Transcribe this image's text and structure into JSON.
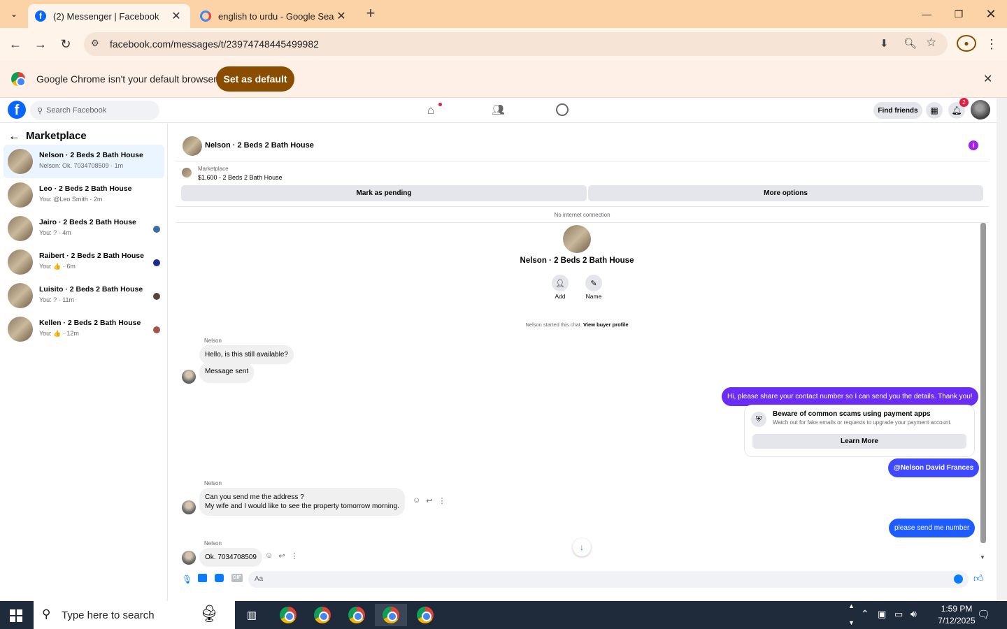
{
  "browser": {
    "tabs": [
      {
        "title": "(2) Messenger | Facebook",
        "active": true
      },
      {
        "title": "english to urdu - Google Search",
        "active": false
      }
    ],
    "url": "facebook.com/messages/t/23974748445499982",
    "default_banner": {
      "message": "Google Chrome isn't your default browser",
      "button": "Set as default"
    }
  },
  "fb_header": {
    "search_placeholder": "Search Facebook",
    "find_friends": "Find friends",
    "notification_count": "2"
  },
  "sidebar": {
    "title": "Marketplace",
    "conversations": [
      {
        "name": "Nelson · 2 Beds 2 Bath House",
        "preview": "Nelson: Ok. 7034708509 · 1m",
        "selected": true,
        "seen_color": ""
      },
      {
        "name": "Leo · 2 Beds 2 Bath House",
        "preview": "You: @Leo Smith · 2m",
        "selected": false,
        "seen_color": ""
      },
      {
        "name": "Jairo · 2 Beds 2 Bath House",
        "preview": "You: ? · 4m",
        "selected": false,
        "seen_color": "#3a6ea5"
      },
      {
        "name": "Raibert · 2 Beds 2 Bath House",
        "preview": "You: 👍 · 6m",
        "selected": false,
        "seen_color": "#1c2b8f"
      },
      {
        "name": "Luisito · 2 Beds 2 Bath House",
        "preview": "You: ? · 11m",
        "selected": false,
        "seen_color": "#5a4636"
      },
      {
        "name": "Kellen · 2 Beds 2 Bath House",
        "preview": "You: 👍 · 12m",
        "selected": false,
        "seen_color": "#a3554a"
      }
    ]
  },
  "chat": {
    "title": "Nelson · 2 Beds 2 Bath House",
    "listing_source": "Marketplace",
    "listing_price": "$1,600 - 2 Beds 2 Bath House",
    "mark_pending": "Mark as pending",
    "more_options": "More options",
    "connection_status": "No internet connection",
    "profile_name": "Nelson · 2 Beds 2 Bath House",
    "add_label": "Add",
    "name_label": "Name",
    "started_text": "Nelson started this chat.",
    "view_buyer": "View buyer profile",
    "sender": "Nelson",
    "msg_available": "Hello, is this still available?",
    "msg_sent": "Message sent",
    "out_contact": "Hi, please share your contact number so I can send you the details. Thank you!",
    "scam_title": "Beware of common scams using payment apps",
    "scam_body": "Watch out for fake emails or requests to upgrade your payment account.",
    "learn_more": "Learn More",
    "out_mention": "@Nelson David Frances",
    "msg_address_1": "Can  you send me the address ?",
    "msg_address_2": "My wife and I would like to see the property tomorrow morning.",
    "out_number": "please send me number",
    "msg_number": "Ok. 7034708509",
    "composer_placeholder": "Aa"
  },
  "taskbar": {
    "search_placeholder": "Type here to search",
    "time": "1:59 PM",
    "date": "7/12/2025"
  },
  "colors": {
    "fb_blue": "#0866ff",
    "bubble_out": "#0a7cff",
    "tab_strip": "#fbd3a6"
  }
}
